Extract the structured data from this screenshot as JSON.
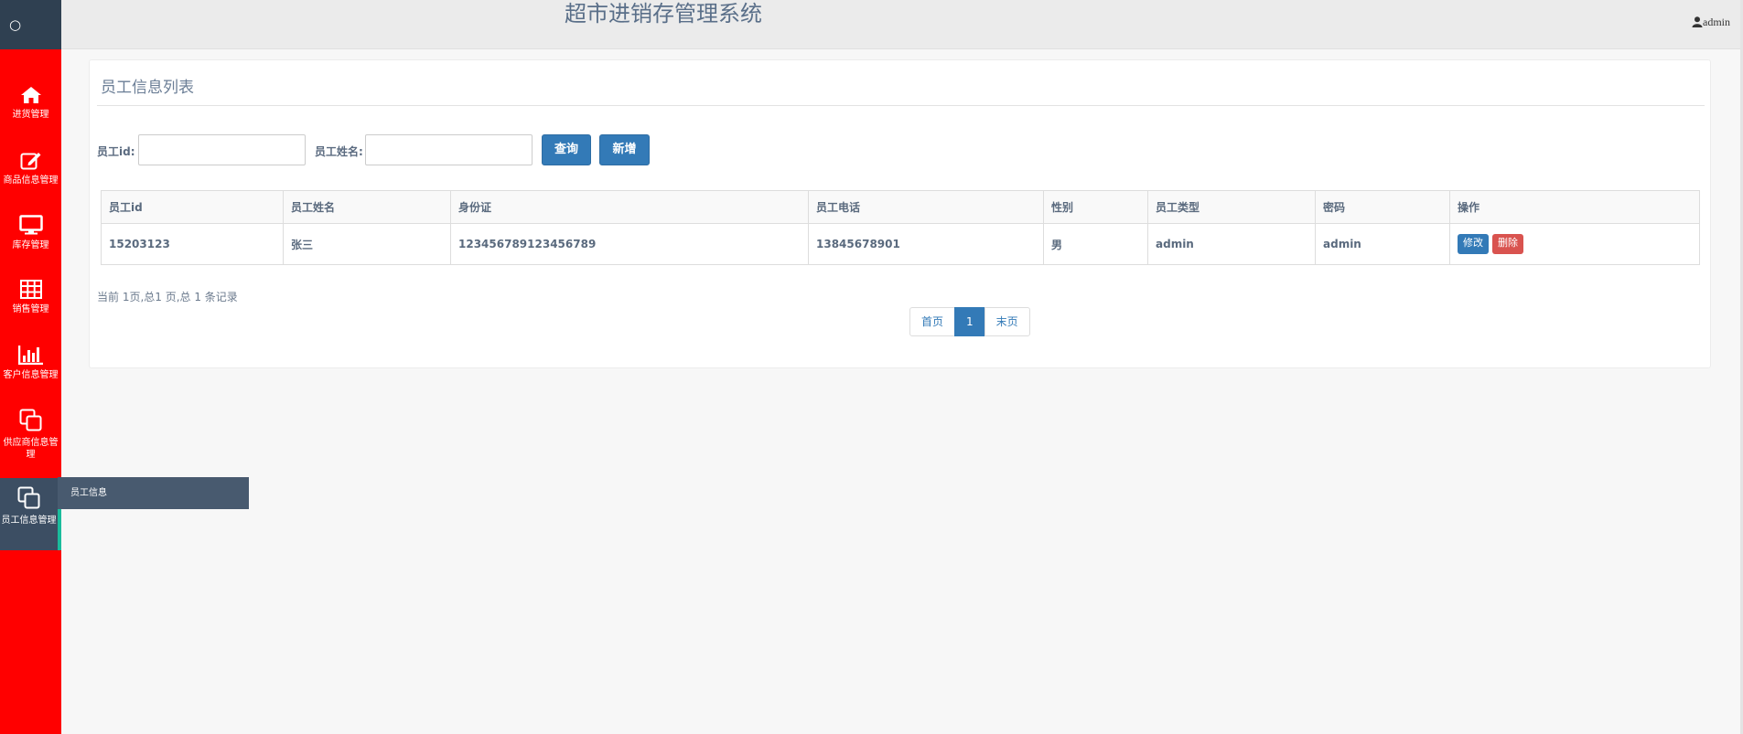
{
  "app": {
    "title": "超市进销存管理系统",
    "user": "admin",
    "logo_glyph": "○"
  },
  "sidebar": {
    "items": [
      {
        "label": "进货管理",
        "icon": "home-icon"
      },
      {
        "label": "商品信息管理",
        "icon": "edit-icon"
      },
      {
        "label": "库存管理",
        "icon": "monitor-icon"
      },
      {
        "label": "销售管理",
        "icon": "table-icon"
      },
      {
        "label": "客户信息管理",
        "icon": "bar-chart-icon"
      },
      {
        "label": "供应商信息管理",
        "icon": "copy-icon"
      },
      {
        "label": "员工信息管理",
        "icon": "copy-icon",
        "active": true
      }
    ],
    "submenu": {
      "label": "员工信息"
    }
  },
  "panel": {
    "title": "员工信息列表"
  },
  "search": {
    "id_label": "员工id:",
    "id_value": "",
    "name_label": "员工姓名:",
    "name_value": "",
    "query_button": "查询",
    "add_button": "新增"
  },
  "table": {
    "headers": [
      "员工id",
      "员工姓名",
      "身份证",
      "员工电话",
      "性别",
      "员工类型",
      "密码",
      "操作"
    ],
    "rows": [
      {
        "id": "15203123",
        "name": "张三",
        "id_card": "123456789123456789",
        "phone": "13845678901",
        "gender": "男",
        "type": "admin",
        "password": "admin",
        "edit_label": "修改",
        "delete_label": "删除"
      }
    ]
  },
  "pagination": {
    "info": "当前 1页,总1 页,总 1 条记录",
    "first": "首页",
    "current": "1",
    "last": "末页"
  },
  "colors": {
    "sidebar": "#ff0000",
    "sidebar_top": "#2f4051",
    "active_item": "#3c4e63",
    "active_border": "#1abc9c",
    "primary": "#337ab7",
    "danger": "#d9534f"
  }
}
